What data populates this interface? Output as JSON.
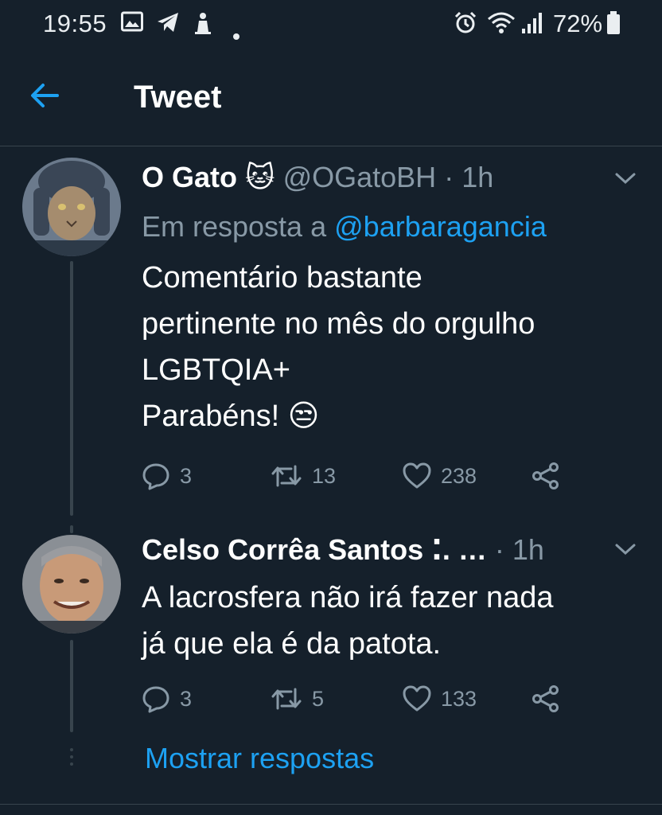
{
  "status_bar": {
    "time": "19:55",
    "icons_left": [
      "image-icon",
      "telegram-icon",
      "notification-icon",
      "dot-icon"
    ],
    "icons_right": [
      "alarm-icon",
      "wifi-icon",
      "signal-icon"
    ],
    "battery": "72%"
  },
  "header": {
    "back_icon": "arrow-left-icon",
    "title": "Tweet"
  },
  "tweets": [
    {
      "name": "O Gato",
      "name_emoji": "🐱",
      "handle": "@OGatoBH",
      "separator": "·",
      "time": "1h",
      "reply_prefix": "Em resposta a",
      "reply_mention": "@barbaragancia",
      "text": "Comentário bastante\npertinente no mês do orgulho\nLGBTQIA+\nParabéns! 😒",
      "replies": "3",
      "retweets": "13",
      "likes": "238"
    },
    {
      "name": "Celso Corrêa Santos",
      "name_suffix": "⁚. …",
      "separator": "·",
      "time": "1h",
      "text": "A lacrosfera não irá fazer nada\njá que ela é da patota.",
      "replies": "3",
      "retweets": "5",
      "likes": "133"
    }
  ],
  "show_replies_label": "Mostrar respostas",
  "colors": {
    "background": "#15202b",
    "accent": "#1da1f2",
    "secondary_text": "#8899a6",
    "divider": "#38444d"
  }
}
